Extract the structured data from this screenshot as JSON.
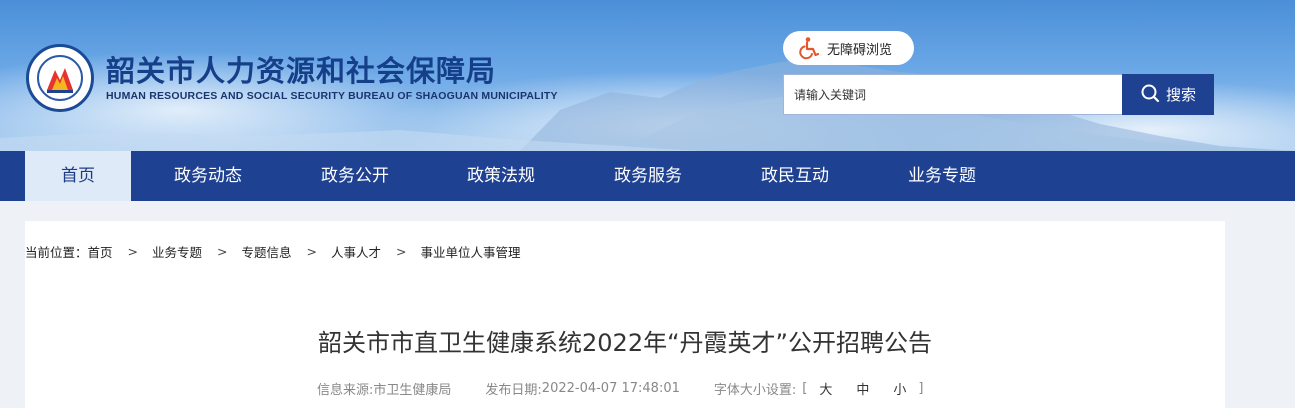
{
  "header": {
    "title": "韶关市人力资源和社会保障局",
    "subtitle": "HUMAN RESOURCES AND SOCIAL SECURITY BUREAU OF SHAOGUAN MUNICIPALITY",
    "logo_icon": "bureau-emblem-icon",
    "accessibility_label": "无障碍浏览",
    "accessibility_icon": "wheelchair-icon",
    "search": {
      "placeholder": "请输入关键词",
      "button_label": "搜索",
      "button_icon": "search-icon"
    }
  },
  "nav": {
    "items": [
      {
        "label": "首页",
        "active": true
      },
      {
        "label": "政务动态"
      },
      {
        "label": "政务公开"
      },
      {
        "label": "政策法规"
      },
      {
        "label": "政务服务"
      },
      {
        "label": "政民互动"
      },
      {
        "label": "业务专题"
      }
    ]
  },
  "breadcrumb": {
    "prefix": "当前位置：",
    "separator": ">",
    "items": [
      "首页",
      "业务专题",
      "专题信息",
      "人事人才",
      "事业单位人事管理"
    ]
  },
  "article": {
    "title": "韶关市市直卫生健康系统2022年“丹霞英才”公开招聘公告",
    "source_label": "信息来源:",
    "source": "市卫生健康局",
    "date_label": "发布日期:",
    "date": "2022-04-07 17:48:01",
    "font_size_label": "字体大小设置:",
    "bracket_open": "[",
    "bracket_close": "]",
    "font_sizes": [
      "大",
      "中",
      "小"
    ]
  },
  "colors": {
    "nav_bg": "#1e4191",
    "nav_active_bg": "#dfeaf8",
    "title_blue": "#163f8a",
    "accessibility_icon": "#e4572e"
  }
}
